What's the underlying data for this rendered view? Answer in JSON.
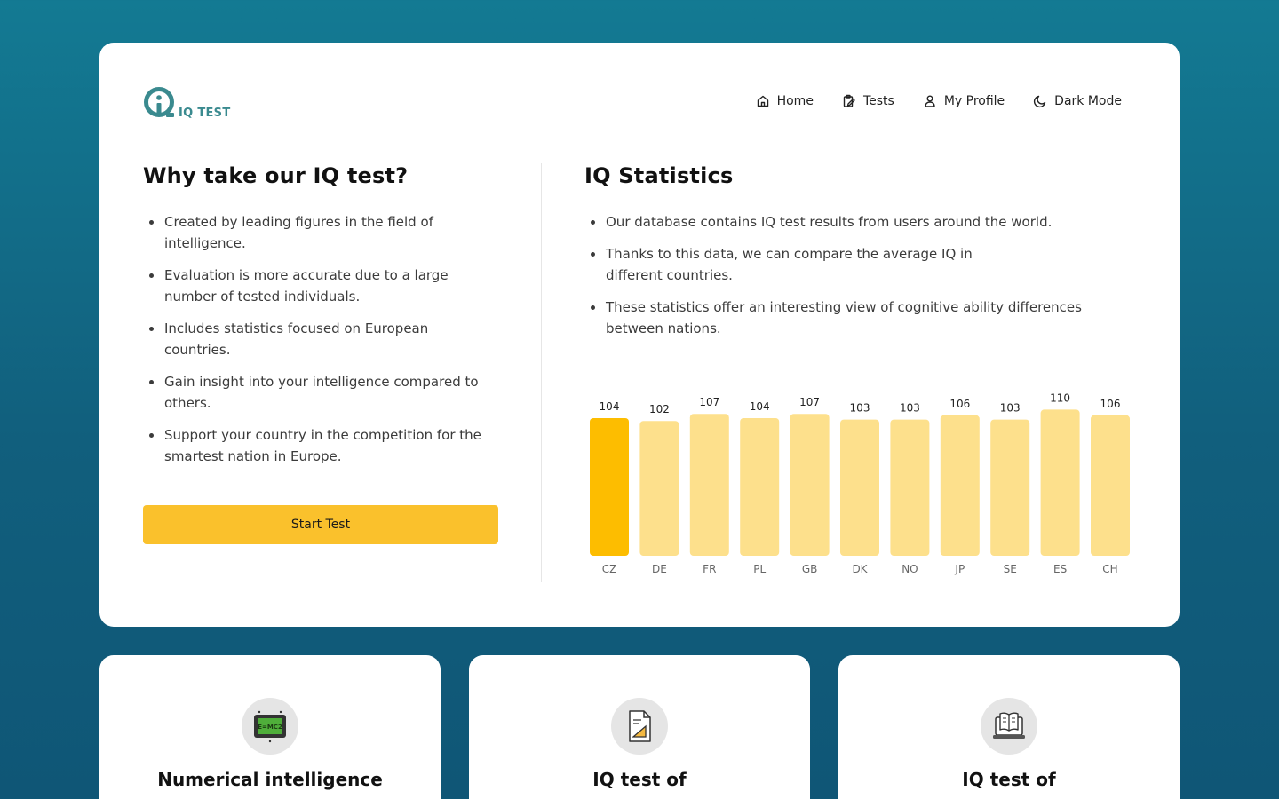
{
  "brand": {
    "name": "IQ TEST",
    "color": "#3a8a8f"
  },
  "nav": [
    {
      "label": "Home",
      "icon": "home-icon"
    },
    {
      "label": "Tests",
      "icon": "clipboard-edit-icon"
    },
    {
      "label": "My Profile",
      "icon": "user-icon"
    },
    {
      "label": "Dark Mode",
      "icon": "moon-icon"
    }
  ],
  "why": {
    "title": "Why take our IQ test?",
    "bullets": [
      "Created by leading figures in the field of intelligence.",
      "Evaluation is more accurate due to a large number of tested individuals.",
      "Includes statistics focused on European countries.",
      "Gain insight into your intelligence compared to others.",
      "Support your country in the competition for the smartest nation in Europe."
    ],
    "button": "Start Test"
  },
  "stats": {
    "title": "IQ Statistics",
    "bullets": [
      "Our database contains IQ test results from users around the world.",
      "Thanks to this data, we can compare the average IQ in different countries.",
      "These statistics offer an interesting view of cognitive ability differences between nations."
    ]
  },
  "chart_data": {
    "type": "bar",
    "categories": [
      "CZ",
      "DE",
      "FR",
      "PL",
      "GB",
      "DK",
      "NO",
      "JP",
      "SE",
      "ES",
      "CH"
    ],
    "values": [
      104,
      102,
      107,
      104,
      107,
      103,
      103,
      106,
      103,
      110,
      106
    ],
    "highlight": "CZ",
    "colors": {
      "highlight": "#fdbd00",
      "default": "#fde08c"
    },
    "grid": false,
    "legend": "none"
  },
  "cards": [
    {
      "title": "Numerical intelligence",
      "icon": "formula-board-icon"
    },
    {
      "title": "IQ test of",
      "icon": "geometry-document-icon"
    },
    {
      "title": "IQ test of",
      "icon": "book-laptop-icon"
    }
  ],
  "colors": {
    "accent": "#fac12c",
    "background_top": "#137a93",
    "background_bottom": "#0f5676"
  }
}
